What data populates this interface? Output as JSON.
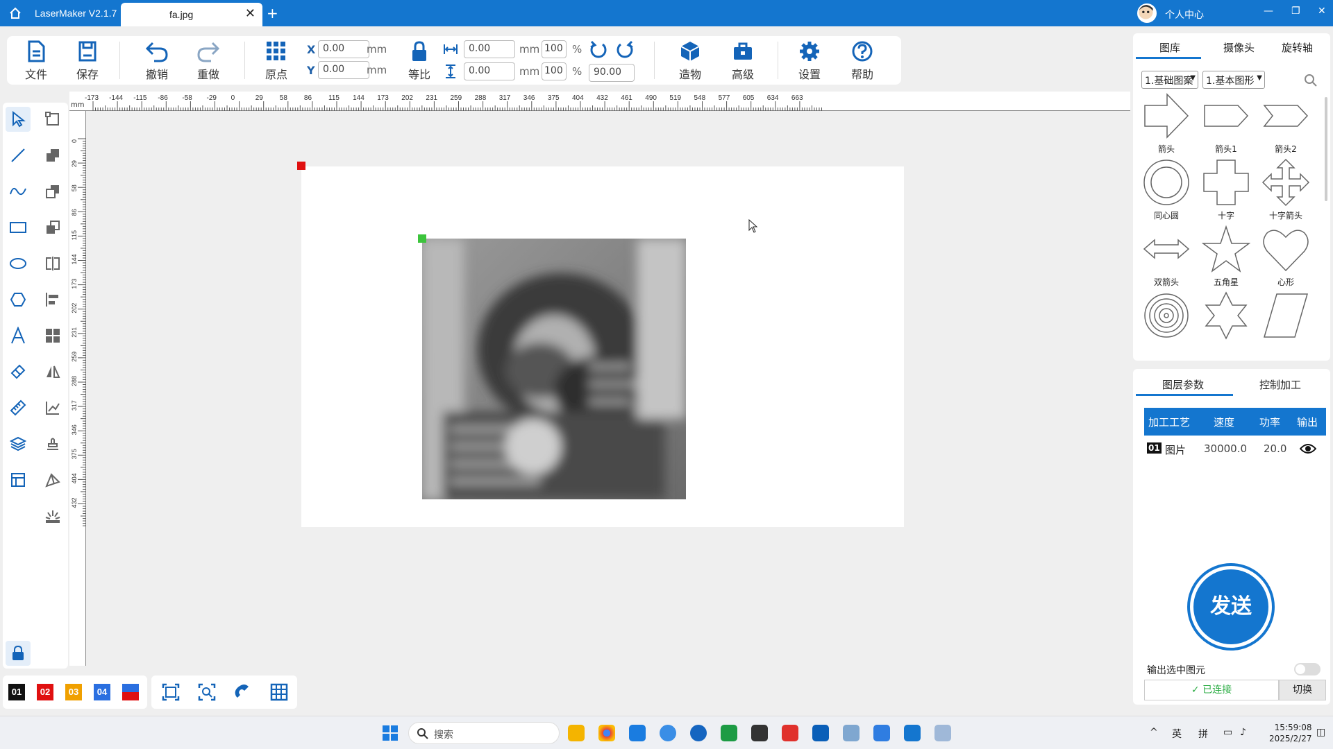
{
  "titlebar": {
    "app_name": "LaserMaker V2.1.7",
    "file_tab": "fa.jpg",
    "user_center": "个人中心"
  },
  "toolbar": {
    "file": "文件",
    "save": "保存",
    "undo": "撤销",
    "redo": "重做",
    "origin": "原点",
    "x_label": "X",
    "y_label": "Y",
    "x_value": "0.00",
    "y_value": "0.00",
    "unit_mm": "mm",
    "lock_ratio": "等比",
    "width_value": "0.00",
    "height_value": "0.00",
    "width_pct": "100",
    "height_pct": "100",
    "pct": "%",
    "rotation": "90.00",
    "create": "造物",
    "advanced": "高级",
    "settings": "设置",
    "help": "帮助"
  },
  "rulers": {
    "unit": "mm",
    "h_labels": [
      "-173",
      "-144",
      "-115",
      "-86",
      "-58",
      "-29",
      "0",
      "29",
      "58",
      "86",
      "115",
      "144",
      "173",
      "202",
      "231",
      "259",
      "288",
      "317",
      "346",
      "375",
      "404",
      "432",
      "461",
      "490",
      "519",
      "548",
      "577",
      "605",
      "634",
      "663"
    ],
    "v_labels": [
      "0",
      "29",
      "58",
      "86",
      "115",
      "144",
      "173",
      "202",
      "231",
      "259",
      "288",
      "317",
      "346",
      "375",
      "404",
      "432"
    ]
  },
  "layer_colors": {
    "items": [
      {
        "label": "01",
        "color": "#111111"
      },
      {
        "label": "02",
        "color": "#e01010"
      },
      {
        "label": "03",
        "color": "#f0a000"
      },
      {
        "label": "04",
        "color": "#2a6fe0"
      }
    ]
  },
  "library_panel": {
    "tabs": [
      "图库",
      "摄像头",
      "旋转轴"
    ],
    "category": "1.基础图案",
    "subcategory": "1.基本图形",
    "shapes": [
      "箭头",
      "箭头1",
      "箭头2",
      "同心圆",
      "十字",
      "十字箭头",
      "双箭头",
      "五角星",
      "心形",
      "",
      "",
      ""
    ]
  },
  "layer_panel": {
    "tabs": [
      "图层参数",
      "控制加工"
    ],
    "columns": [
      "加工工艺",
      "速度",
      "功率",
      "输出"
    ],
    "rows": [
      {
        "badge": "01",
        "type": "图片",
        "speed": "30000.0",
        "power": "20.0"
      }
    ],
    "send": "发送",
    "output_selected": "输出选中图元",
    "connected": "已连接",
    "switch": "切换"
  },
  "taskbar": {
    "search": "搜索",
    "ime1": "英",
    "ime2": "拼",
    "time": "15:59:08",
    "date": "2025/2/27"
  },
  "colors": {
    "accent": "#1476cf",
    "handle_red": "#e01010",
    "handle_green": "#3cc43c",
    "connected_green": "#2fae47"
  }
}
